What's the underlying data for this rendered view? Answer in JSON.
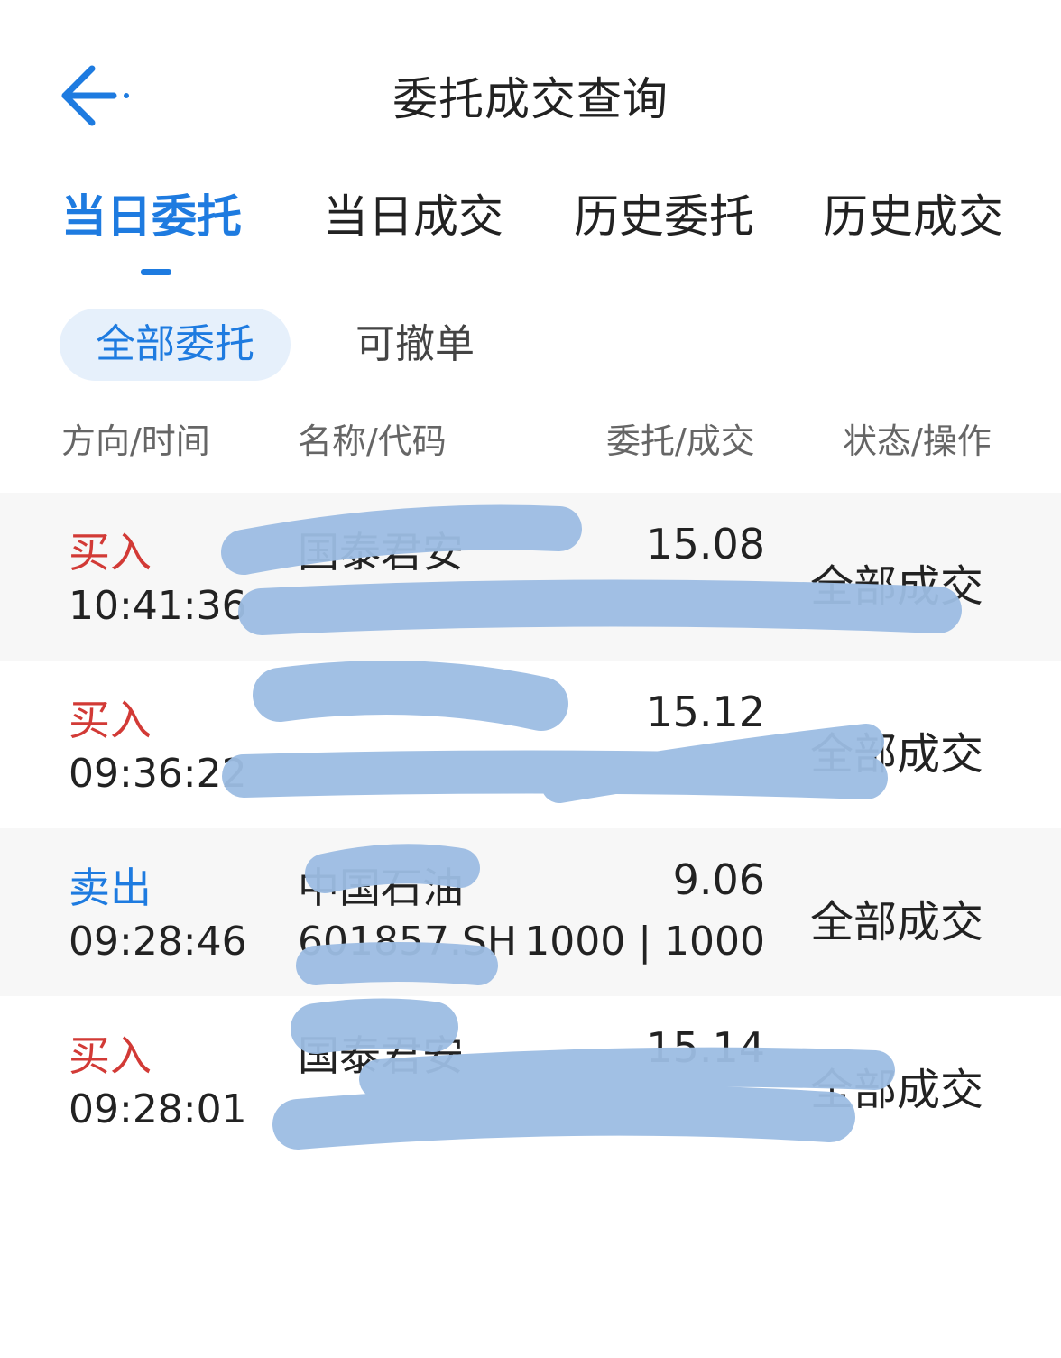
{
  "header": {
    "back_icon": "arrow-left-icon",
    "title": "委托成交查询"
  },
  "tabs": [
    {
      "label": "当日委托",
      "active": true
    },
    {
      "label": "当日成交",
      "active": false
    },
    {
      "label": "历史委托",
      "active": false
    },
    {
      "label": "历史成交",
      "active": false
    }
  ],
  "filters": {
    "all": "全部委托",
    "cancelable": "可撤单"
  },
  "columns": {
    "direction_time": "方向/时间",
    "name_code": "名称/代码",
    "order_deal": "委托/成交",
    "status_action": "状态/操作"
  },
  "orders": [
    {
      "direction": "买入",
      "time": "10:41:36",
      "name": "国泰君安",
      "code": "",
      "price": "15.08",
      "qty": "",
      "status": "全部成交"
    },
    {
      "direction": "买入",
      "time": "09:36:22",
      "name": "",
      "code": "",
      "price": "15.12",
      "qty": "",
      "status": "全部成交"
    },
    {
      "direction": "卖出",
      "time": "09:28:46",
      "name": "中国石油",
      "code": "601857.SH",
      "price": "9.06",
      "qty": "1000 | 1000",
      "status": "全部成交"
    },
    {
      "direction": "买入",
      "time": "09:28:01",
      "name": "国泰君安",
      "code": "",
      "price": "15.14",
      "qty": "",
      "status": "全部成交"
    }
  ],
  "colors": {
    "accent": "#1e7be0",
    "buy": "#d23a36",
    "sell": "#1e7be0",
    "redaction": "#9dbde3"
  }
}
